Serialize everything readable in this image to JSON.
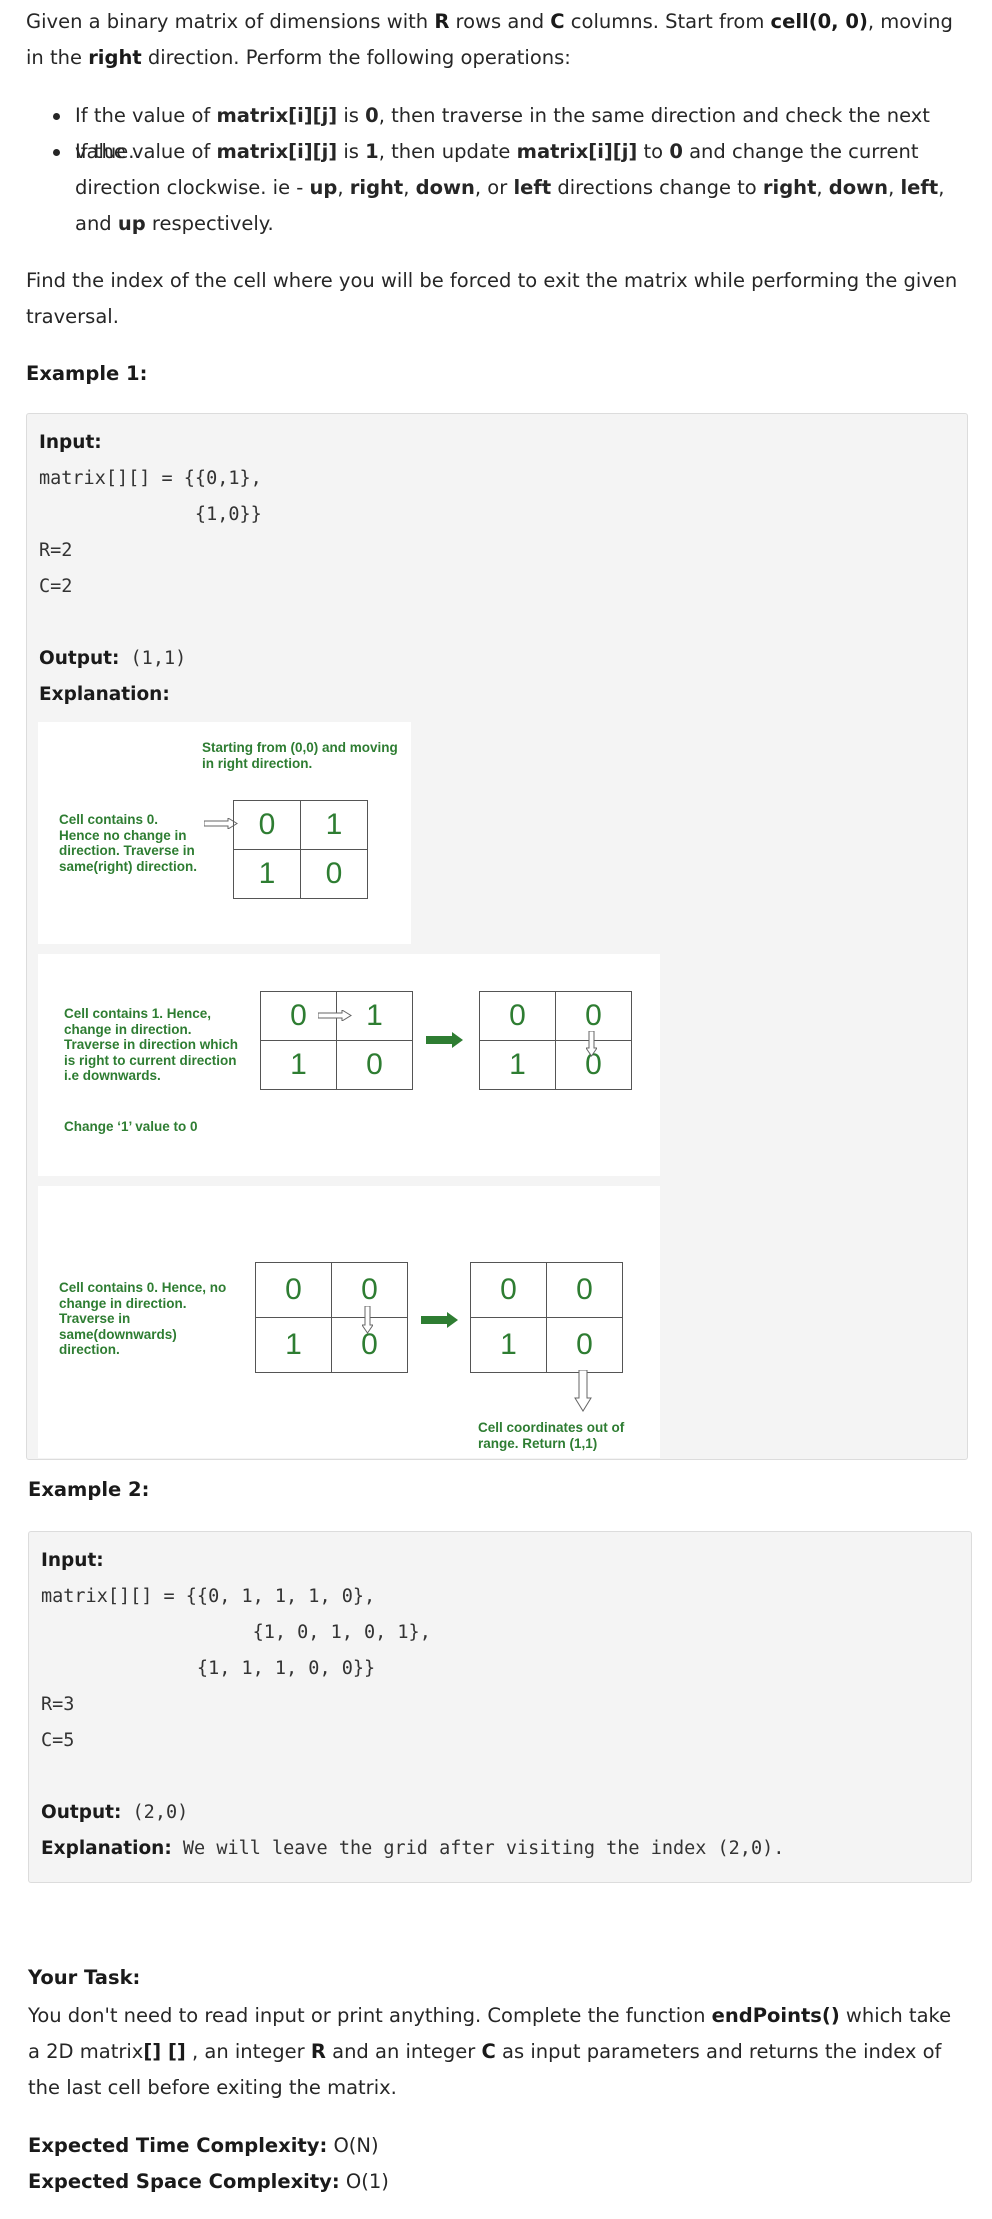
{
  "intro": {
    "t1": "Given a binary matrix of dimensions  with ",
    "r": "R",
    "t2": " rows and ",
    "c": "C",
    "t3": " columns. Start from ",
    "cell": "cell(0, 0)",
    "t4": ", moving in the ",
    "right": "right",
    "t5": " direction. Perform the following operations:"
  },
  "bullet1": {
    "t1": "If the value of ",
    "m": "matrix[i][j]",
    "t2": " is ",
    "zero": "0",
    "t3": ", then traverse in the same direction and check the next value."
  },
  "bullet2": {
    "t1": "If the value of ",
    "m": "matrix[i][j]",
    "t2": " is ",
    "one": "1",
    "t3": ", then update ",
    "m2": "matrix[i][j]",
    "t4": " to ",
    "zero": "0",
    "t5": " and change the current direction clockwise. ie - ",
    "up": "up",
    "c1": ", ",
    "right": "right",
    "c2": ", ",
    "down": "down",
    "t6": ", or ",
    "left": "left",
    "t7": " directions change to ",
    "right2": "right",
    "c3": ", ",
    "down2": "down",
    "c4": ", ",
    "left2": "left",
    "t8": ",",
    "t9": "and ",
    "up2": "up",
    "t10": " respectively."
  },
  "find_text": "Find the index of the cell where you will be forced to exit the matrix while performing the given traversal.",
  "example1": {
    "heading": "Example 1:",
    "input_label": "Input:",
    "line1": "matrix[][] = {{0,1},",
    "line2": "              {1,0}}",
    "r": "R=2",
    "c": "C=2",
    "output_label": "Output:",
    "output_value": " (1,1)",
    "explanation_label": "Explanation:"
  },
  "diagram": {
    "step1": {
      "title": "Starting from (0,0) and moving in right direction.",
      "note": "Cell contains 0. Hence no change in direction. Traverse in same(right) direction.",
      "grid": [
        [
          "0",
          "1"
        ],
        [
          "1",
          "0"
        ]
      ]
    },
    "step2": {
      "note": "Cell contains 1.  Hence, change in direction. Traverse in direction which is right to current direction i.e downwards.",
      "note2": "Change ‘1’ value to  0",
      "grid_before": [
        [
          "0",
          "1"
        ],
        [
          "1",
          "0"
        ]
      ],
      "grid_after": [
        [
          "0",
          "0"
        ],
        [
          "1",
          "0"
        ]
      ]
    },
    "step3": {
      "note": "Cell contains 0.  Hence, no change in direction. Traverse in same(downwards) direction.",
      "grid_before": [
        [
          "0",
          "0"
        ],
        [
          "1",
          "0"
        ]
      ],
      "grid_after": [
        [
          "0",
          "0"
        ],
        [
          "1",
          "0"
        ]
      ],
      "result": "Cell coordinates out of range. Return (1,1)"
    },
    "colors": {
      "text": "#2e7d32",
      "arrow": "#2e7d32"
    }
  },
  "example2": {
    "heading": "Example 2:",
    "input_label": "Input:",
    "line1": "matrix[][] = {{0, 1, 1, 1, 0},",
    "line2": "                   {1, 0, 1, 0, 1},",
    "line3": "              {1, 1, 1, 0, 0}}",
    "r": "R=3",
    "c": "C=5",
    "output_label": "Output:",
    "output_value": " (2,0)",
    "explanation_label": "Explanation:",
    "explanation_text": " We will leave the grid after visiting the index (2,0)."
  },
  "task": {
    "heading": "Your Task:",
    "t1": "You don't need to read input or print anything. Complete the function ",
    "fn": "endPoints()",
    "t2": " which take a 2D matrix",
    "arr": "[] []",
    "t3": " , an integer ",
    "r": "R",
    "t4": " and an integer ",
    "c": "C",
    "t5": " as input parameters and returns the index of the last cell before exiting the matrix."
  },
  "complexity": {
    "time_label": "Expected Time Complexity:",
    "time_value": " O(N)",
    "space_label": "Expected Space Complexity:",
    "space_value": " O(1)"
  }
}
